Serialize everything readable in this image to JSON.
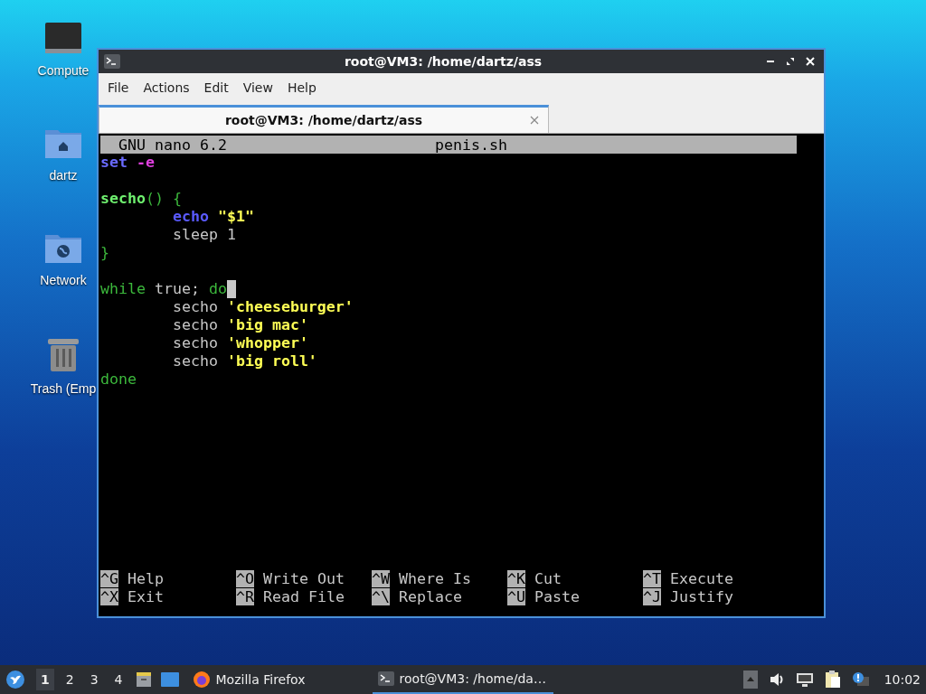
{
  "desktop_icons": [
    {
      "label": "Compute",
      "kind": "computer"
    },
    {
      "label": "dartz",
      "kind": "home"
    },
    {
      "label": "Network",
      "kind": "network"
    },
    {
      "label": "Trash (Emp",
      "kind": "trash"
    }
  ],
  "window": {
    "title": "root@VM3: /home/dartz/ass",
    "menu": [
      "File",
      "Actions",
      "Edit",
      "View",
      "Help"
    ],
    "tabs": [
      {
        "label": "root@VM3: /home/dartz/ass",
        "selected": true
      }
    ]
  },
  "nano": {
    "version": "GNU nano 6.2",
    "filename": "penis.sh",
    "lines": [
      {
        "kind": "code",
        "indented": false,
        "cursor": false,
        "tokens": [
          {
            "text": "set",
            "kind": "builtin"
          },
          {
            "text": " -e",
            "kind": "option"
          }
        ]
      },
      {
        "kind": "blank"
      },
      {
        "kind": "code",
        "indented": false,
        "cursor": false,
        "tokens": [
          {
            "text": "secho",
            "kind": "function"
          },
          {
            "text": "() {",
            "kind": "keyword"
          }
        ]
      },
      {
        "kind": "code",
        "indented": true,
        "cursor": false,
        "tokens": [
          {
            "text": "echo",
            "kind": "command"
          },
          {
            "text": " \"$1\"",
            "kind": "string"
          }
        ]
      },
      {
        "kind": "code",
        "indented": true,
        "cursor": false,
        "tokens": [
          {
            "text": "sleep 1",
            "kind": "plain"
          }
        ]
      },
      {
        "kind": "code",
        "indented": false,
        "cursor": false,
        "tokens": [
          {
            "text": "}",
            "kind": "keyword"
          }
        ]
      },
      {
        "kind": "blank"
      },
      {
        "kind": "code",
        "indented": false,
        "cursor": true,
        "tokens": [
          {
            "text": "while",
            "kind": "keyword"
          },
          {
            "text": " true; ",
            "kind": "plain"
          },
          {
            "text": "do",
            "kind": "keyword"
          }
        ]
      },
      {
        "kind": "code",
        "indented": true,
        "cursor": false,
        "tokens": [
          {
            "text": "secho ",
            "kind": "plain"
          },
          {
            "text": "'cheeseburger'",
            "kind": "string"
          }
        ]
      },
      {
        "kind": "code",
        "indented": true,
        "cursor": false,
        "tokens": [
          {
            "text": "secho ",
            "kind": "plain"
          },
          {
            "text": "'big mac'",
            "kind": "string"
          }
        ]
      },
      {
        "kind": "code",
        "indented": true,
        "cursor": false,
        "tokens": [
          {
            "text": "secho ",
            "kind": "plain"
          },
          {
            "text": "'whopper'",
            "kind": "string"
          }
        ]
      },
      {
        "kind": "code",
        "indented": true,
        "cursor": false,
        "tokens": [
          {
            "text": "secho ",
            "kind": "plain"
          },
          {
            "text": "'big roll'",
            "kind": "string"
          }
        ]
      },
      {
        "kind": "code",
        "indented": false,
        "cursor": false,
        "tokens": [
          {
            "text": "done",
            "kind": "keyword"
          }
        ]
      }
    ],
    "shortcuts": [
      [
        {
          "key": "^G",
          "label": "Help"
        },
        {
          "key": "^O",
          "label": "Write Out"
        },
        {
          "key": "^W",
          "label": "Where Is"
        },
        {
          "key": "^K",
          "label": "Cut"
        },
        {
          "key": "^T",
          "label": "Execute"
        }
      ],
      [
        {
          "key": "^X",
          "label": "Exit"
        },
        {
          "key": "^R",
          "label": "Read File"
        },
        {
          "key": "^\\",
          "label": "Replace"
        },
        {
          "key": "^U",
          "label": "Paste"
        },
        {
          "key": "^J",
          "label": "Justify"
        }
      ]
    ]
  },
  "taskbar": {
    "workspaces": [
      {
        "label": "1",
        "selected": true
      },
      {
        "label": "2",
        "selected": false
      },
      {
        "label": "3",
        "selected": false
      },
      {
        "label": "4",
        "selected": false
      }
    ],
    "tasks": [
      {
        "label": "Mozilla Firefox",
        "kind": "browser",
        "active": false
      },
      {
        "label": "root@VM3: /home/da…",
        "kind": "terminal",
        "active": true
      }
    ],
    "clock": "10:02"
  }
}
